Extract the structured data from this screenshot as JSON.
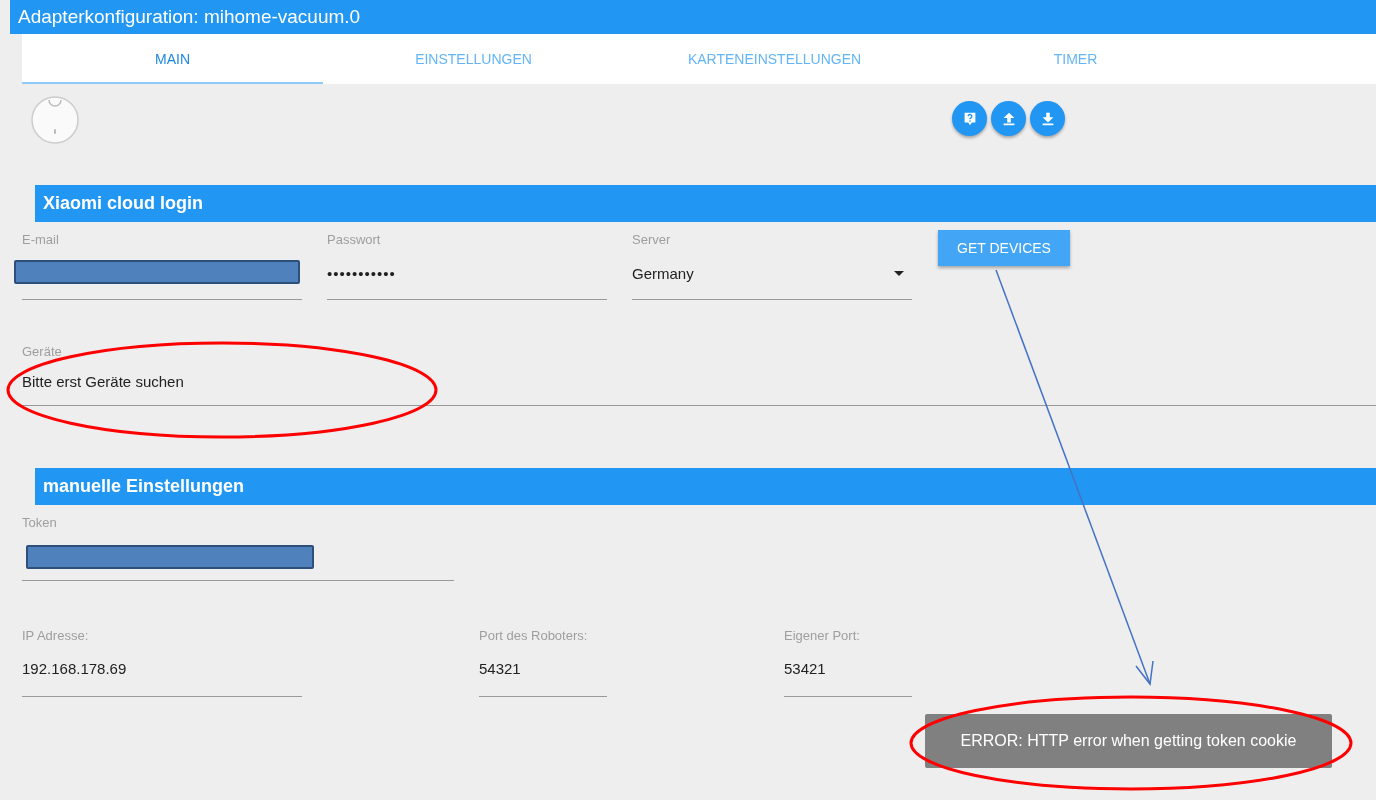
{
  "window": {
    "title": "Adapterkonfiguration: mihome-vacuum.0"
  },
  "tabs": [
    {
      "label": "MAIN",
      "selected": true
    },
    {
      "label": "EINSTELLUNGEN",
      "selected": false
    },
    {
      "label": "KARTENEINSTELLUNGEN",
      "selected": false
    },
    {
      "label": "TIMER",
      "selected": false
    }
  ],
  "cloud_section": {
    "title": "Xiaomi cloud login",
    "fields": [
      {
        "kind": "text",
        "label": "E-mail",
        "redacted": true
      },
      {
        "kind": "text",
        "label": "Passwort",
        "value": "•••••••••••",
        "redacted": false
      },
      {
        "kind": "select",
        "label": "Server",
        "value": "Germany",
        "redacted": false
      }
    ],
    "button": "GET DEVICES",
    "devices": {
      "label": "Geräte",
      "value": "Bitte erst Geräte suchen"
    }
  },
  "manual_section": {
    "title": "manuelle Einstellungen",
    "token": {
      "label": "Token",
      "redacted": true
    },
    "fields": [
      {
        "label": "IP Adresse:",
        "value": "192.168.178.69"
      },
      {
        "label": "Port des Roboters:",
        "value": "54321"
      },
      {
        "label": "Eigener Port:",
        "value": "53421"
      }
    ]
  },
  "toast": {
    "message": "ERROR: HTTP error when getting token cookie"
  }
}
